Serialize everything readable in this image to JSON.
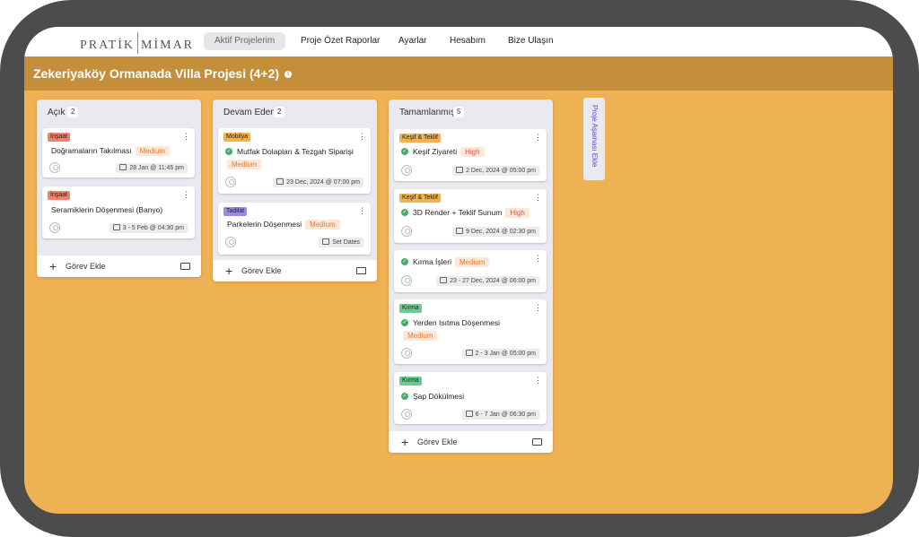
{
  "nav": {
    "logo_left": "PRATİK",
    "logo_right": "MİMAR",
    "items": [
      {
        "label": "Aktif Projelerim",
        "active": true
      },
      {
        "label": "Proje Özet Raporlar"
      },
      {
        "label": "Ayarlar"
      },
      {
        "label": "Hesabım"
      },
      {
        "label": "Bize Ulaşın"
      }
    ]
  },
  "project": {
    "title": "Zekeriyaköy Ormanada Villa Projesi (4+2)",
    "info_icon": "info-icon"
  },
  "columns": [
    {
      "title": "Açık",
      "count": "2",
      "cards": [
        {
          "tag": "İnşaat",
          "tag_color": "#f0826a",
          "title": "Doğramaların Takılması",
          "priority": "Medium",
          "date": "28 Jan @ 11:45 pm"
        },
        {
          "tag": "İnşaat",
          "tag_color": "#f0826a",
          "title": "Seramiklerin Döşenmesi (Banyo)",
          "priority": "",
          "date": "3 - 5 Feb @ 04:30 pm"
        }
      ],
      "add_label": "Görev Ekle"
    },
    {
      "title": "Devam Eden",
      "count": "2",
      "cards": [
        {
          "tag": "Mobilya",
          "tag_color": "#f2b04e",
          "title": "Mutfak Dolapları & Tezgah Siparişi",
          "priority": "Medium",
          "date": "23 Dec, 2024 @ 07:00 pm",
          "done": true
        },
        {
          "tag": "Tadilat",
          "tag_color": "#9b8be8",
          "title": "Parkelerin Döşenmesi",
          "priority": "Medium",
          "date": "Set Dates"
        }
      ],
      "add_label": "Görev Ekle"
    },
    {
      "title": "Tamamlanmış",
      "count": "5",
      "cards": [
        {
          "tag": "Keşif & Teklif",
          "tag_color": "#f2b04e",
          "title": "Keşif Ziyareti",
          "priority": "High",
          "date": "2 Dec, 2024 @ 05:00 pm",
          "done": true
        },
        {
          "tag": "Keşif & Teklif",
          "tag_color": "#f2b04e",
          "title": "3D Render + Teklif Sunum",
          "priority": "High",
          "date": "9 Dec, 2024 @ 02:30 pm",
          "done": true
        },
        {
          "tag": "",
          "title": "Kırma İşleri",
          "priority": "Medium",
          "date": "23 - 27 Dec, 2024 @ 06:00 pm",
          "done": true
        },
        {
          "tag": "Kırma",
          "tag_color": "#6cc992",
          "title": "Yerden Isıtma Döşenmesi",
          "priority": "Medium",
          "date": "2 - 3 Jan @ 05:00 pm",
          "done": true
        },
        {
          "tag": "Kırma",
          "tag_color": "#6cc992",
          "title": "Şap Dökülmesi",
          "priority": "",
          "date": "6 - 7 Jan @ 06:30 pm",
          "done": true
        }
      ],
      "add_label": "Görev Ekle"
    }
  ],
  "add_stage": {
    "label": "Proje Aşaması Ekle"
  },
  "colors": {
    "background": "#eeb154",
    "title_bar": "#c48e3b",
    "accent_purple": "#5a4fc0",
    "check_green": "#4aaa6a"
  }
}
